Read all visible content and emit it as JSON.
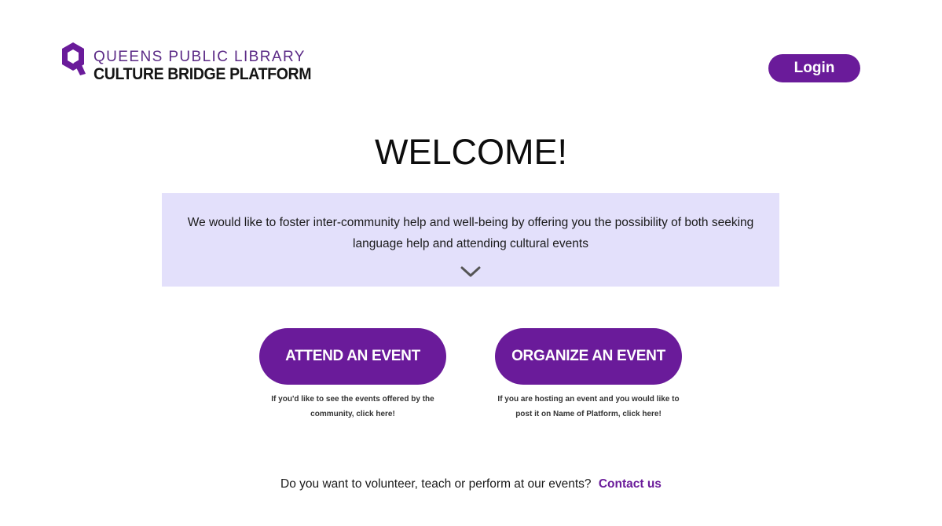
{
  "header": {
    "logo_line1": "QUEENS PUBLIC LIBRARY",
    "logo_line2": "CULTURE BRIDGE PLATFORM",
    "login_label": "Login"
  },
  "hero": {
    "title": "WELCOME!",
    "intro": "We would like to foster inter-community help and well-being by offering you the possibility of both seeking language help and attending cultural events"
  },
  "actions": {
    "attend_label": "ATTEND AN EVENT",
    "attend_caption": "If you'd like to see the events offered by the community, click here!",
    "organize_label": "ORGANIZE AN EVENT",
    "organize_caption": "If you are hosting an event and you would like to post it on Name of Platform, click here!"
  },
  "footer": {
    "question": "Do you want to volunteer, teach or perform at our events?",
    "contact_label": "Contact us"
  },
  "colors": {
    "brand_purple": "#6a1b9a",
    "logo_purple": "#5b2a86",
    "intro_background": "#e3e0fb"
  },
  "icons": {
    "logo": "library-q-logo-icon",
    "expand": "chevron-down-icon"
  }
}
